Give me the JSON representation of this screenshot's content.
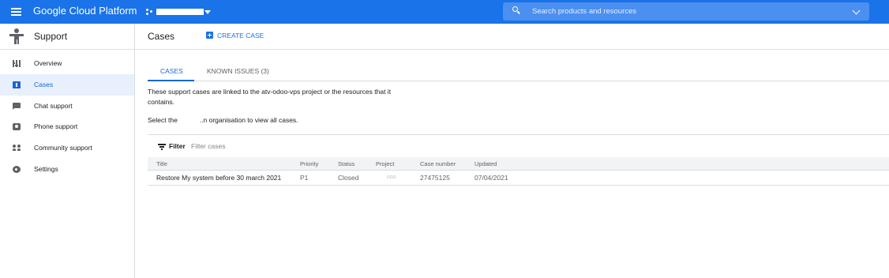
{
  "app": {
    "title": "Google Cloud Platform",
    "accent_color": "#1a73e8"
  },
  "search": {
    "placeholder": "Search products and resources"
  },
  "sidebar": {
    "title": "Support",
    "items": [
      {
        "label": "Overview",
        "icon": "overview-icon",
        "active": false
      },
      {
        "label": "Cases",
        "icon": "cases-icon",
        "active": true
      },
      {
        "label": "Chat support",
        "icon": "chat-icon",
        "active": false
      },
      {
        "label": "Phone support",
        "icon": "phone-icon",
        "active": false
      },
      {
        "label": "Community support",
        "icon": "community-icon",
        "active": false
      },
      {
        "label": "Settings",
        "icon": "gear-icon",
        "active": false
      }
    ]
  },
  "main": {
    "title": "Cases",
    "create_label": "CREATE CASE",
    "tabs": [
      {
        "label": "CASES",
        "active": true
      },
      {
        "label": "KNOWN ISSUES (3)",
        "active": false
      }
    ],
    "description": "These support cases are linked to the atv-odoo-vps project or the resources that it contains.",
    "select_prefix": "Select the",
    "select_suffix": "..n organisation to view all cases.",
    "filter_label": "Filter",
    "filter_placeholder": "Filter cases",
    "table": {
      "columns": [
        "Title",
        "Priority",
        "Status",
        "Project",
        "Case number",
        "Updated"
      ],
      "rows": [
        {
          "title": "Restore My system before 30 march 2021",
          "priority": "P1",
          "status": "Closed",
          "project": "ooo",
          "case_number": "27475125",
          "updated": "07/04/2021"
        }
      ]
    }
  }
}
